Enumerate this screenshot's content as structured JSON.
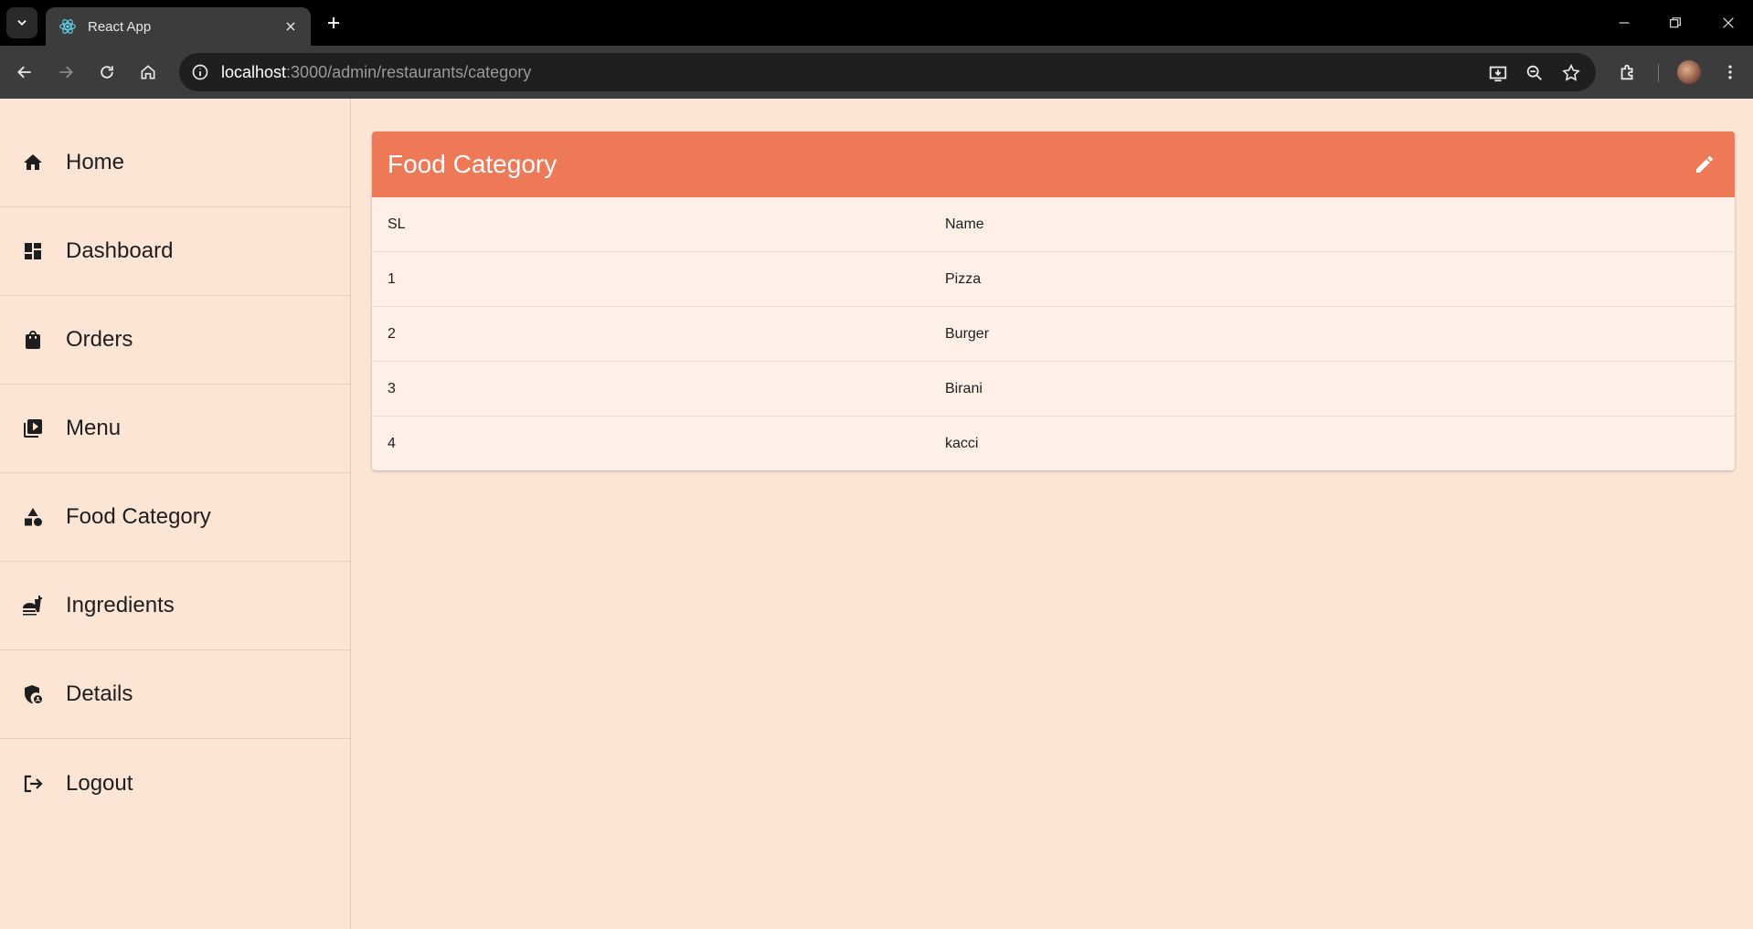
{
  "browser": {
    "tab_title": "React App",
    "url_host": "localhost",
    "url_path": ":3000/admin/restaurants/category"
  },
  "sidebar": {
    "items": [
      {
        "label": "Home",
        "icon": "home-icon"
      },
      {
        "label": "Dashboard",
        "icon": "dashboard-icon"
      },
      {
        "label": "Orders",
        "icon": "shopping-bag-icon"
      },
      {
        "label": "Menu",
        "icon": "menu-icon"
      },
      {
        "label": "Food Category",
        "icon": "category-icon"
      },
      {
        "label": "Ingredients",
        "icon": "fastfood-icon"
      },
      {
        "label": "Details",
        "icon": "admin-shield-icon"
      },
      {
        "label": "Logout",
        "icon": "logout-icon"
      }
    ]
  },
  "card": {
    "title": "Food Category",
    "columns": [
      "SL",
      "Name"
    ],
    "rows": [
      {
        "sl": "1",
        "name": "Pizza"
      },
      {
        "sl": "2",
        "name": "Burger"
      },
      {
        "sl": "3",
        "name": "Birani"
      },
      {
        "sl": "4",
        "name": "kacci"
      }
    ]
  },
  "colors": {
    "accent": "#ee7957",
    "background": "#fde5d6",
    "card_background": "#fef0e6"
  }
}
